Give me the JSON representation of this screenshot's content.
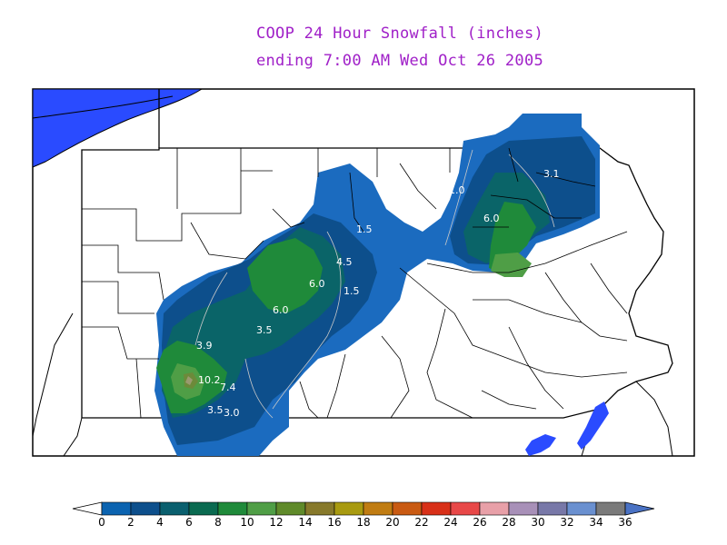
{
  "title_line1": "COOP 24 Hour Snowfall (inches)",
  "title_line2": "ending 7:00 AM Wed Oct 26 2005",
  "colors": {
    "water": "#2a4bff",
    "blue_light": "#1b6bbf",
    "blue_dark": "#0d4f8c",
    "teal": "#0a6468",
    "green": "#1f8a3a",
    "green_light": "#4f9e46",
    "olive": "#6c8a3a"
  },
  "contour_labels": [
    "3.1",
    "1.0",
    "6.0",
    "1.5",
    "4.5",
    "6.0",
    "1.5",
    "6.0",
    "3.5",
    "3.9",
    "10.2",
    "7.4",
    "3.5",
    "3.0"
  ],
  "colorbar": {
    "ticks": [
      "0",
      "2",
      "4",
      "6",
      "8",
      "10",
      "12",
      "14",
      "16",
      "18",
      "20",
      "22",
      "24",
      "26",
      "28",
      "30",
      "32",
      "34",
      "36"
    ],
    "colors": [
      "#0b63b0",
      "#0d4f8c",
      "#0a5f6e",
      "#0a6a50",
      "#1f8a3a",
      "#4f9e46",
      "#5f8a2a",
      "#87792b",
      "#a89a10",
      "#c07c12",
      "#c95a12",
      "#d83018",
      "#e84848",
      "#e8a0a8",
      "#a890b8",
      "#7878a8",
      "#6a90d0",
      "#7a7a7a",
      "#4a72c4"
    ]
  }
}
